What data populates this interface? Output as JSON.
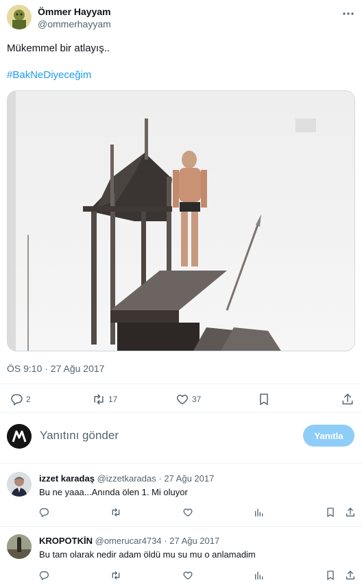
{
  "tweet": {
    "author_name": "Ömmer Hayyam",
    "author_handle": "@ommerhayyam",
    "text": "Mükemmel bir atlayış..",
    "hashtag": "#BakNeDiyeceğim",
    "timestamp": "ÖS 9:10 · 27 Ağu 2017",
    "replies": "2",
    "retweets": "17",
    "likes": "37"
  },
  "compose": {
    "placeholder": "Yanıtını gönder",
    "button_label": "Yanıtla"
  },
  "replies": [
    {
      "name": "izzet karadaş",
      "handle": "@izzetkaradas",
      "date": "· 27 Ağu 2017",
      "text": "Bu ne yaaa...Anında ölen 1. Mi oluyor"
    },
    {
      "name": "KROPOTKİN",
      "handle": "@omerucar4734",
      "date": "· 27 Ağu 2017",
      "text": "Bu tam olarak nedir adam öldü mu su mu o anlamadim"
    }
  ],
  "colors": {
    "accent": "#1d9bf0",
    "accent_disabled": "#8ecdf8",
    "muted": "#536471",
    "divider": "#eff3f4"
  }
}
